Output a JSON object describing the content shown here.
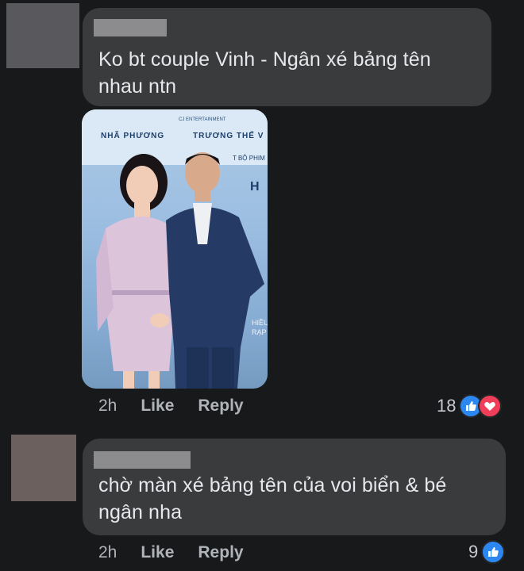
{
  "comments": [
    {
      "text": "Ko bt couple Vinh - Ngân xé bảng tên nhau ntn",
      "time": "2h",
      "like_label": "Like",
      "reply_label": "Reply",
      "reaction_count": "18",
      "reactions": [
        "like-icon",
        "love-icon"
      ],
      "photo": {
        "names": [
          "NHÃ PHƯƠNG",
          "TRƯƠNG THẾ V"
        ],
        "tagline": "T BỘ PHIM",
        "side_text": [
          "HIỀU",
          "RẠP"
        ],
        "logo_text": "CJ ENTERTAINMENT"
      }
    },
    {
      "text": "chờ màn xé bảng tên của voi biển & bé ngân nha",
      "time": "2h",
      "like_label": "Like",
      "reply_label": "Reply",
      "reaction_count": "9",
      "reactions": [
        "like-icon"
      ]
    }
  ],
  "colors": {
    "background": "#18191b",
    "bubble": "#3a3b3d",
    "like_blue": "#2d87f0",
    "love_red": "#ef3d5a"
  }
}
